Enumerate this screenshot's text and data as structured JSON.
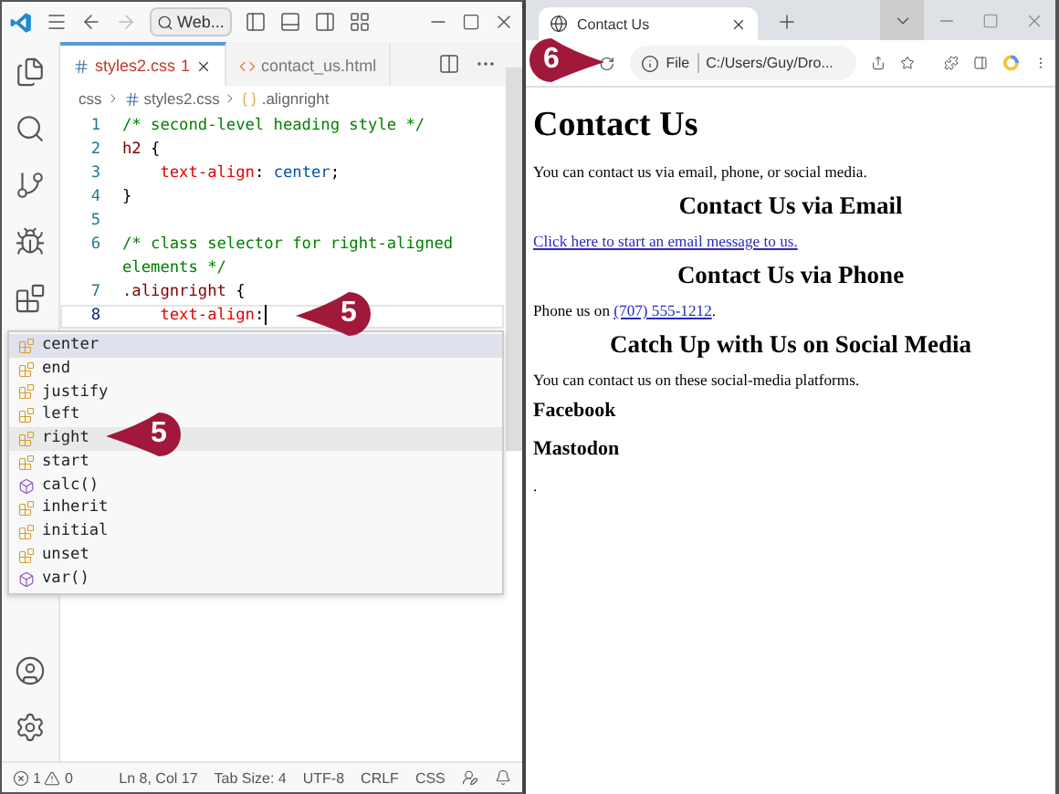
{
  "editor": {
    "search": "Web...",
    "tabs": [
      {
        "label": "styles2.css",
        "badge": "1",
        "kind": "css",
        "selected": true
      },
      {
        "label": "contact_us.html",
        "kind": "html",
        "selected": false
      }
    ],
    "breadcrumbs": [
      {
        "label": "css",
        "kind": "folder"
      },
      {
        "label": "styles2.css",
        "kind": "css"
      },
      {
        "label": ".alignright",
        "kind": "symbol"
      }
    ],
    "lines": [
      {
        "number": "1",
        "current": false,
        "segments": [
          {
            "kind": "comment",
            "text": "/* second-level heading style */"
          }
        ]
      },
      {
        "number": "2",
        "current": false,
        "segments": [
          {
            "kind": "selector",
            "text": "h2"
          },
          {
            "kind": "punct",
            "text": " {"
          }
        ]
      },
      {
        "number": "3",
        "current": false,
        "segments": [
          {
            "kind": "property",
            "text": "    text-align"
          },
          {
            "kind": "punct",
            "text": ": "
          },
          {
            "kind": "value",
            "text": "center"
          },
          {
            "kind": "punct",
            "text": ";"
          }
        ]
      },
      {
        "number": "4",
        "current": false,
        "segments": [
          {
            "kind": "punct",
            "text": "}"
          }
        ]
      },
      {
        "number": "5",
        "current": false
      },
      {
        "number": "6",
        "current": false,
        "segments": [
          {
            "kind": "comment",
            "text": "/* class selector for right-aligned elements */"
          }
        ]
      },
      {
        "number": "7",
        "current": false,
        "segments": [
          {
            "kind": "selector",
            "text": ".alignright"
          },
          {
            "kind": "punct",
            "text": " {"
          }
        ]
      },
      {
        "number": "8",
        "current": true,
        "segments": [
          {
            "kind": "property",
            "text": "    text-align"
          },
          {
            "kind": "punct",
            "text": ":"
          }
        ]
      }
    ],
    "suggestions": [
      {
        "label": "center",
        "kind": "value",
        "selected": true,
        "hovered": false
      },
      {
        "label": "end",
        "kind": "value",
        "selected": false,
        "hovered": false
      },
      {
        "label": "justify",
        "kind": "value",
        "selected": false,
        "hovered": false
      },
      {
        "label": "left",
        "kind": "value",
        "selected": false,
        "hovered": false
      },
      {
        "label": "right",
        "kind": "value",
        "selected": false,
        "hovered": true
      },
      {
        "label": "start",
        "kind": "value",
        "selected": false,
        "hovered": false
      },
      {
        "label": "calc()",
        "kind": "function",
        "selected": false,
        "hovered": false
      },
      {
        "label": "inherit",
        "kind": "value",
        "selected": false,
        "hovered": false
      },
      {
        "label": "initial",
        "kind": "value",
        "selected": false,
        "hovered": false
      },
      {
        "label": "unset",
        "kind": "value",
        "selected": false,
        "hovered": false
      },
      {
        "label": "var()",
        "kind": "function",
        "selected": false,
        "hovered": false
      }
    ],
    "status_bar": {
      "errors": "1",
      "warnings": "0",
      "items": [
        "Ln 8, Col 17",
        "Tab Size: 4",
        "UTF-8",
        "CRLF",
        "CSS"
      ]
    }
  },
  "browser": {
    "tab": {
      "title": "Contact Us"
    },
    "address": {
      "scheme": "File",
      "path": "C:/Users/Guy/Dro..."
    },
    "page": [
      {
        "kind": "h1",
        "text": "Contact Us"
      },
      {
        "kind": "p",
        "text": "You can contact us via email, phone, or social media."
      },
      {
        "kind": "h2",
        "text": "Contact Us via Email"
      },
      {
        "kind": "link",
        "text": "Click here to start an email message to us."
      },
      {
        "kind": "h2",
        "text": "Contact Us via Phone"
      },
      {
        "kind": "phone",
        "text": "Phone us on ",
        "link": "(707) 555-1212",
        "after": "."
      },
      {
        "kind": "h2",
        "text": "Catch Up with Us on Social Media"
      },
      {
        "kind": "p",
        "text": "You can contact us on these social-media platforms."
      },
      {
        "kind": "h3",
        "text": "Facebook"
      },
      {
        "kind": "h3",
        "text": "Mastodon"
      },
      {
        "kind": "p",
        "text": "."
      }
    ]
  },
  "callouts": [
    {
      "number": "5"
    },
    {
      "number": "5"
    },
    {
      "number": "6"
    }
  ]
}
